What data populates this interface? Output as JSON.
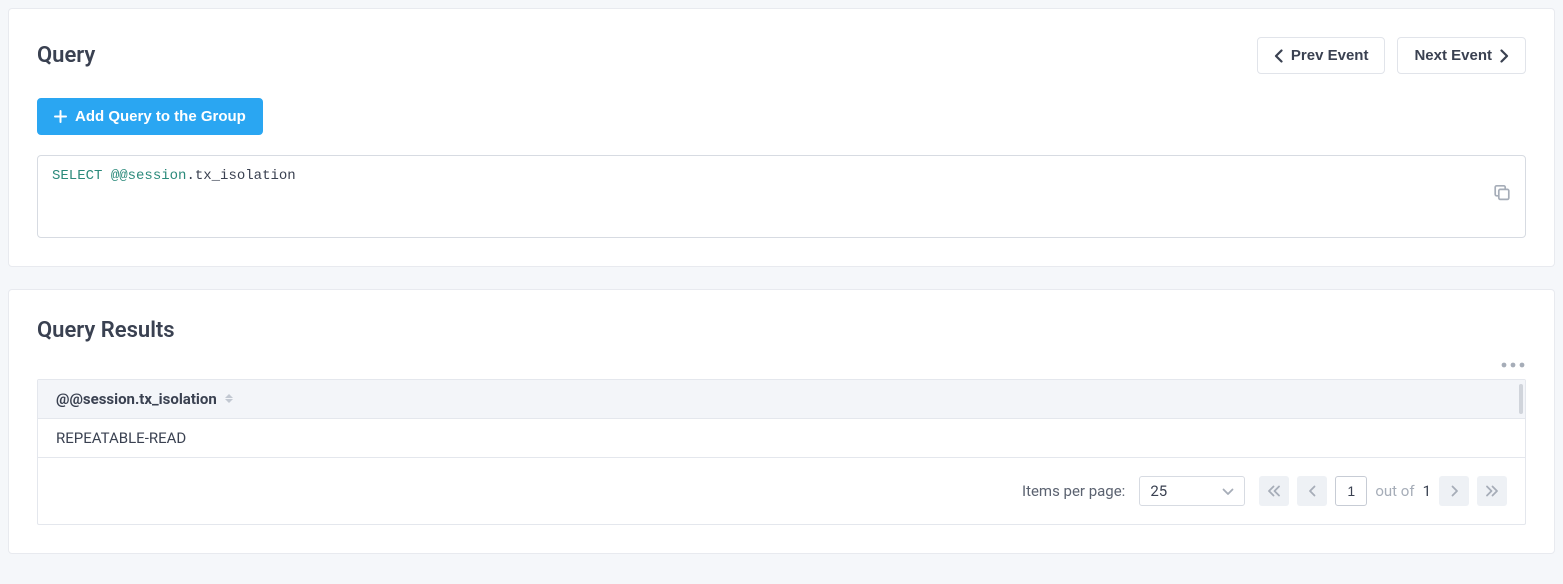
{
  "query_panel": {
    "title": "Query",
    "prev_label": "Prev Event",
    "next_label": "Next Event",
    "add_label": "Add Query to the Group",
    "sql": {
      "keyword": "SELECT",
      "var": "@@session",
      "rest": ".tx_isolation"
    }
  },
  "results_panel": {
    "title": "Query Results",
    "column_header": "@@session.tx_isolation",
    "rows": [
      "REPEATABLE-READ"
    ],
    "footer": {
      "items_label": "Items per page:",
      "per_page": "25",
      "current_page": "1",
      "outof_label": "out of",
      "total_pages": "1"
    }
  }
}
